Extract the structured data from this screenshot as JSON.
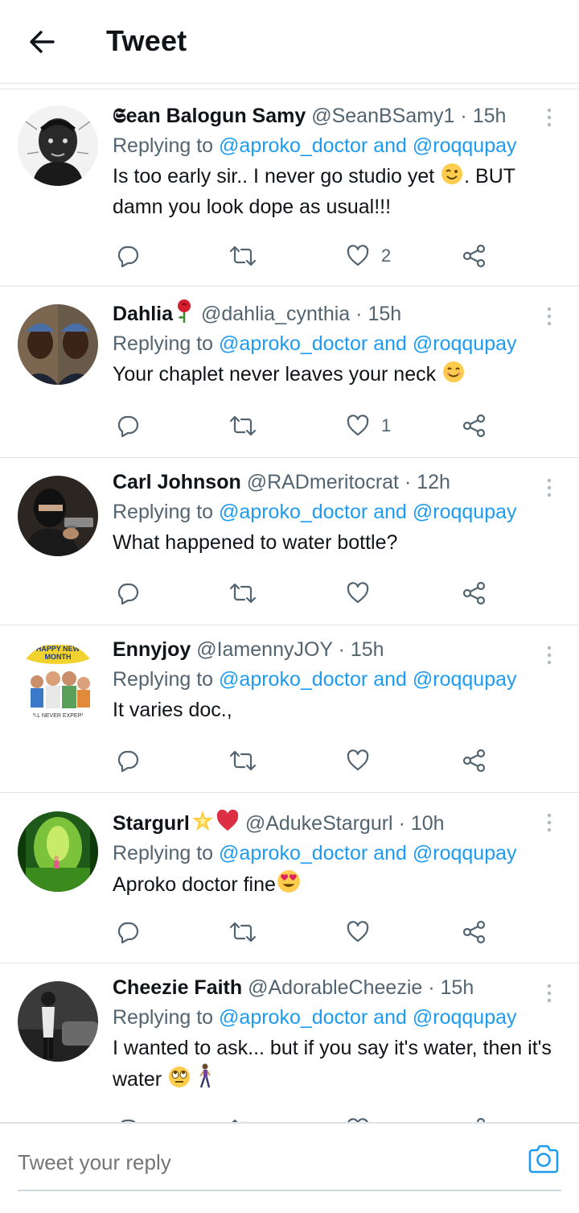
{
  "header": {
    "title": "Tweet"
  },
  "replying_prefix": "Replying to",
  "replying_and": "and",
  "mentions": [
    "@aproko_doctor",
    "@roqqupay"
  ],
  "colors": {
    "accent": "#1d9bf0",
    "muted": "#536471",
    "text": "#0f1419",
    "divider": "#dfe3e6"
  },
  "tweets": [
    {
      "name": "𝕾ean Balogun Samy",
      "handle": "@SeanBSamy1",
      "dot": "·",
      "time": "15h",
      "text_1": "Is too early sir.. I never go studio yet",
      "emoji_1": "wink-emoji",
      "text_2": ". BUT damn you look dope as usual!!!",
      "likes": "2"
    },
    {
      "name": "Dahlia",
      "name_emoji": "rose-emoji",
      "handle": "@dahlia_cynthia",
      "dot": "·",
      "time": "15h",
      "text_1": "Your chaplet never leaves your neck",
      "emoji_1": "smile-emoji",
      "likes": "1"
    },
    {
      "name": "Carl Johnson",
      "handle": "@RADmeritocrat",
      "dot": "·",
      "time": "12h",
      "text_1": "What happened to water bottle?",
      "likes": ""
    },
    {
      "name": "Ennyjoy",
      "handle": "@IamennyJOY",
      "dot": "·",
      "time": "15h",
      "text_1": "It varies doc.,",
      "likes": "",
      "avatar_text_top": "HAPPY NEW",
      "avatar_text_mid": "MONTH",
      "avatar_text_bottom": "ILL NEVER EXPERI"
    },
    {
      "name": "Stargurl",
      "name_emoji": "star-heart-emoji",
      "handle": "@AdukeStargurl",
      "dot": "·",
      "time": "10h",
      "text_1": "Aproko doctor fine",
      "emoji_1": "heart-eyes-emoji",
      "likes": ""
    },
    {
      "name": "Cheezie Faith",
      "handle": "@AdorableCheezie",
      "dot": "·",
      "time": "15h",
      "text_1": "I wanted to ask... but if you say it's water, then it's water",
      "emoji_1": "eye-roll-emoji",
      "likes": ""
    }
  ],
  "composer": {
    "placeholder": "Tweet your reply"
  }
}
